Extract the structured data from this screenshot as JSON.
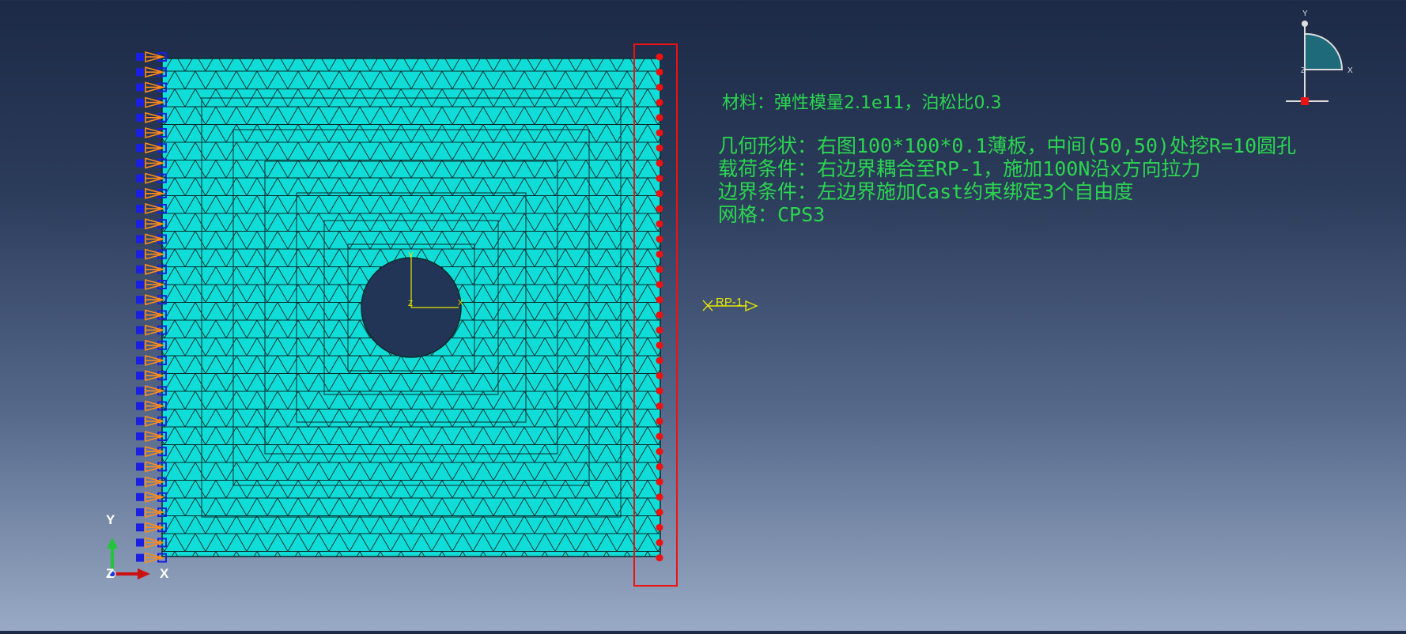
{
  "annotations": {
    "material": "材料：弹性模量2.1e11，泊松比0.3",
    "geometry": "几何形状：右图100*100*0.1薄板，中间(50,50)处挖R=10圆孔",
    "load": "载荷条件：右边界耦合至RP-1，施加100N沿x方向拉力",
    "boundary": "边界条件：左边界施加Cast约束绑定3个自由度",
    "mesh": "网格：CPS3"
  },
  "reference_point": {
    "label": "RP-1"
  },
  "triad": {
    "x": "X",
    "y": "Y",
    "z": "Z"
  },
  "view_cube": {
    "x": "X",
    "y": "Y",
    "z": "Z"
  },
  "hole_csys": {
    "x": "X",
    "y": "Y",
    "z": "Z"
  },
  "mesh_info": {
    "element_type": "CPS3"
  },
  "colors": {
    "mesh_fill": "#10ddd8",
    "mesh_lines": "#0a2a2a",
    "bc_marker": "#1a20e0",
    "bc_arrow": "#ff8c1a",
    "coupling": "#ee1111",
    "annotation": "#2bd64f",
    "csys": "#e6e600"
  }
}
